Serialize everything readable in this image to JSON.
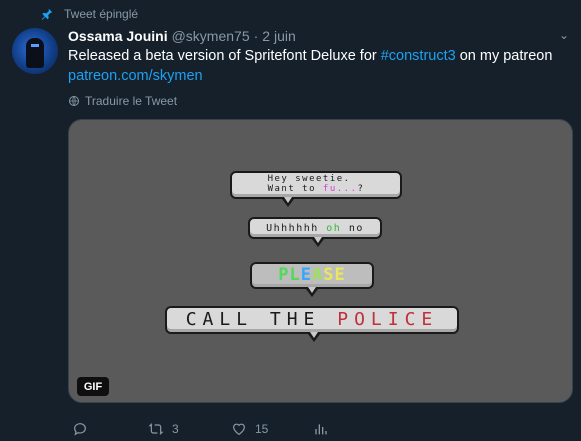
{
  "pinned_label": "Tweet épinglé",
  "author": {
    "name": "Ossama Jouini",
    "handle": "@skymen75",
    "separator": "·",
    "date": "2 juin"
  },
  "tweet": {
    "text_before": "Released a beta version of Spritefont Deluxe for ",
    "hashtag": "#construct3",
    "text_after": " on my patreon",
    "link": "patreon.com/skymen"
  },
  "translate_label": "Traduire le Tweet",
  "media": {
    "badge": "GIF",
    "bubble1": {
      "line1": "Hey sweetie.",
      "line2_prefix": "Want to ",
      "line2_colored": "fu...",
      "line2_suffix": "?"
    },
    "bubble2": {
      "prefix": "Uhhhhhh ",
      "colored": "oh",
      "suffix": " no"
    },
    "bubble3": {
      "letters": [
        "PL",
        "E",
        "A",
        "SE"
      ]
    },
    "bubble4": {
      "plain": "CALL THE ",
      "colored": "POLICE"
    }
  },
  "actions": {
    "reply_count": "",
    "retweet_count": "3",
    "like_count": "15"
  },
  "colors": {
    "background": "#15202b",
    "muted": "#8899a6",
    "link": "#1da1f2",
    "pin": "#1da1f2"
  },
  "icons": {
    "pin": "pin-icon",
    "more": "chevron-down-icon",
    "translate": "globe-icon",
    "reply": "reply-icon",
    "retweet": "retweet-icon",
    "like": "heart-icon",
    "stats": "stats-icon"
  }
}
